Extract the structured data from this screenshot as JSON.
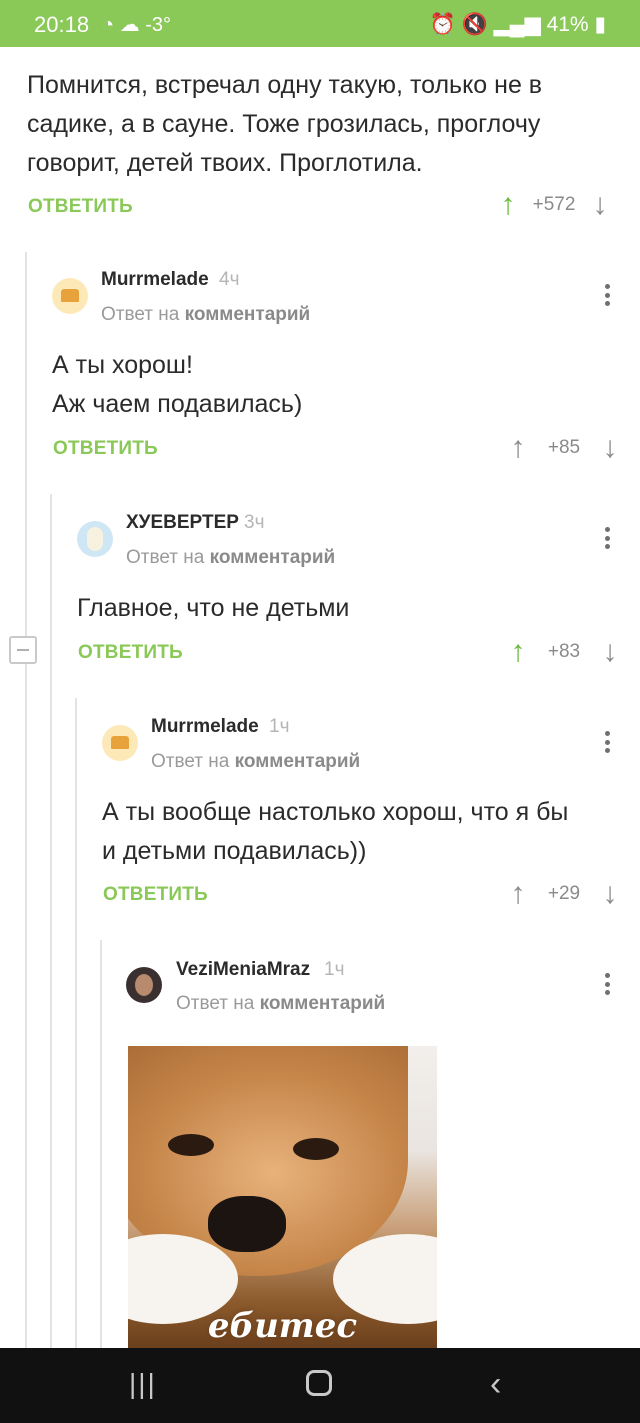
{
  "status_bar": {
    "time": "20:18",
    "temperature": "-3°",
    "battery": "41%"
  },
  "post": {
    "text_lines": [
      "Помнится, встречал одну такую, только не в",
      "садике, а в сауне. Тоже грозилась, проглочу",
      "говорит, детей твоих. Проглотила."
    ],
    "reply_label": "ОТВЕТИТЬ",
    "score": "+572"
  },
  "comments": [
    {
      "author": "Murrmelade",
      "time": "4ч",
      "reply_to_prefix": "Ответ на",
      "reply_to_target": "комментарий",
      "text_lines": [
        "А ты хорош!",
        "Аж чаем подавилась)"
      ],
      "reply_label": "ОТВЕТИТЬ",
      "score": "+85"
    },
    {
      "author": "ХУЕВЕРТЕР",
      "time": "3ч",
      "reply_to_prefix": "Ответ на",
      "reply_to_target": "комментарий",
      "text_lines": [
        "Главное, что не детьми"
      ],
      "reply_label": "ОТВЕТИТЬ",
      "score": "+83"
    },
    {
      "author": "Murrmelade",
      "time": "1ч",
      "reply_to_prefix": "Ответ на",
      "reply_to_target": "комментарий",
      "text_lines": [
        "А ты вообще настолько хорош, что я бы",
        "и детьми подавилась))"
      ],
      "reply_label": "ОТВЕТИТЬ",
      "score": "+29"
    },
    {
      "author": "VeziMeniaMraz",
      "time": "1ч",
      "reply_to_prefix": "Ответ на",
      "reply_to_target": "комментарий",
      "image_caption": "ебитес"
    }
  ],
  "icons": {
    "upvote": "arrow-up-icon",
    "downvote": "arrow-down-icon",
    "menu": "more-vertical-icon",
    "collapse": "collapse-icon",
    "nav_recents": "recents-icon",
    "nav_home": "home-icon",
    "nav_back": "back-icon"
  },
  "colors": {
    "accent": "#8ac858",
    "upvote_active": "#6ab83c",
    "muted": "#8a8a8a"
  }
}
